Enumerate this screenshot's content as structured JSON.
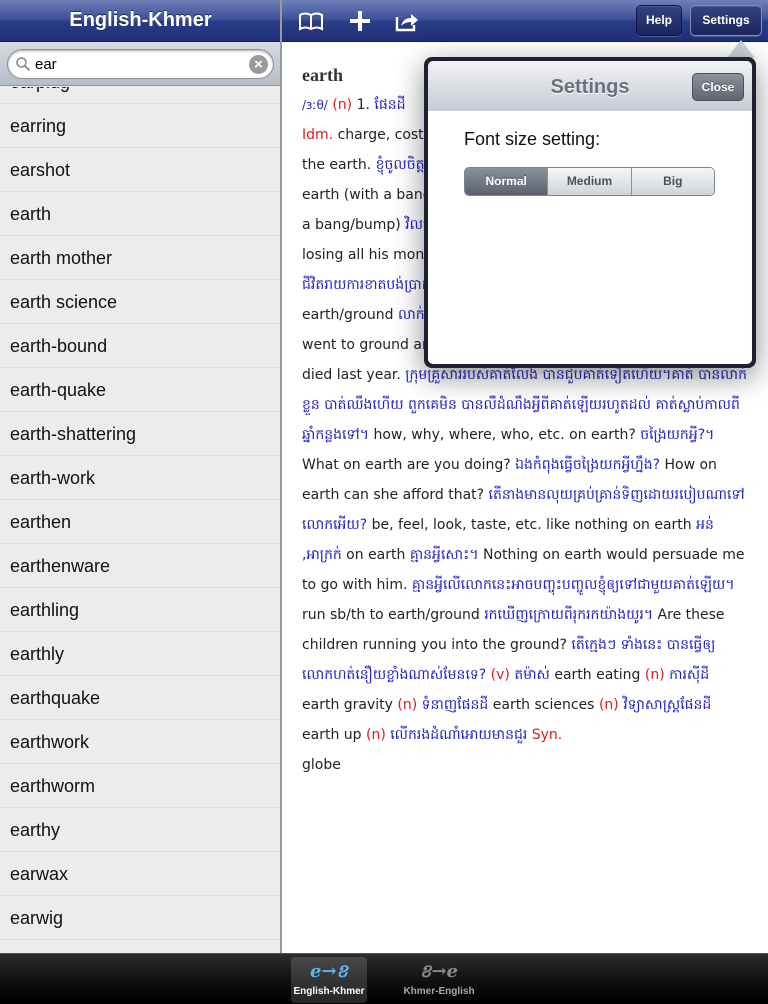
{
  "sidebar": {
    "title": "English-Khmer",
    "search": {
      "value": "ear",
      "placeholder": ""
    },
    "icons": {
      "search": "search-icon",
      "clear": "clear-icon"
    },
    "items": [
      "earplug",
      "earring",
      "earshot",
      "earth",
      "earth mother",
      "earth science",
      "earth-bound",
      "earth-quake",
      "earth-shattering",
      "earth-work",
      "earthen",
      "earthenware",
      "earthling",
      "earthly",
      "earthquake",
      "earthwork",
      "earthworm",
      "earthy",
      "earwax",
      "earwig"
    ]
  },
  "toolbar": {
    "icons": [
      "book-icon",
      "add-icon",
      "share-icon"
    ],
    "help_label": "Help",
    "settings_label": "Settings"
  },
  "entry": {
    "headword": "earth",
    "ipa": "/ɜːθ/",
    "segments": [
      [
        "pos",
        "(n)"
      ],
      [
        "en",
        " 1. "
      ],
      [
        "kh",
        "ផែនដី"
      ],
      [
        "br",
        ""
      ],
      [
        "pos",
        "Idm."
      ],
      [
        "en",
        " charge, cost, etc. the earth: I love that dress, but it costs the earth. "
      ],
      [
        "kh",
        "ខ្ញុំចូលចិត្តរ៉ូបនោះ តែវាមានតំលៃខ្ពស់ពេក"
      ],
      [
        "en",
        " come (back) down to earth (with a bang/bump); bring sb (back) down to earth (with a bang/bump) "
      ],
      [
        "kh",
        "វិលត្រឡប់មកការពិតវិញ"
      ],
      [
        "en",
        " After his wonderful holiday, losing all his money brought him back to earth with a bump. "
      ],
      [
        "kh",
        "ជីវិតរាយការខាតបង់ប្រាក់ ធ្វើឲ្យនាងក្លាយជាមនុស្សធម្មតាវិញ។"
      ],
      [
        "en",
        " go to earth/ground "
      ],
      [
        "kh",
        "លាក់បំពួន។"
      ],
      [
        "en",
        " His family never saw him again. He went to ground and they heard nothing else of him until he died last year. "
      ],
      [
        "kh",
        "ក្រុមគ្រួសាររបស់គាត់លែង បានជួបគាត់ទៀតហើយ។គាត់ បានលាក់ខ្លួន បាត់ឈឹងហើយ ពួកគេមិន បានលឺដំណឹងអ្វីពីគាត់ឡើយរហូតដល់ គាត់ស្លាប់កាលពីឆ្នាំកន្លងទៅ។"
      ],
      [
        "en",
        " how, why, where, who, etc. on earth? "
      ],
      [
        "kh",
        "ចង្រៃយកអ្វី?។"
      ],
      [
        "en",
        " What on earth are you doing? "
      ],
      [
        "kh",
        "ឯងកំពុងធ្វើចង្រៃយកអ្វីហ្នឹង?"
      ],
      [
        "en",
        " How on earth can she afford that? "
      ],
      [
        "kh",
        "តើនាងមានលុយគ្រប់គ្រាន់ទិញដោយរបៀបណាទៅលោកអើយ?"
      ],
      [
        "en",
        " be, feel, look, taste, etc. like nothing on earth "
      ],
      [
        "kh",
        "អន់ ,អាក្រក់"
      ],
      [
        "en",
        " on earth "
      ],
      [
        "kh",
        "គ្មានអ្វីសោះ។"
      ],
      [
        "en",
        " Nothing on earth would persuade me to go with him. "
      ],
      [
        "kh",
        "គ្មានអ្វីលើលោកនេះអាចបញ្ចុះបញ្ចូលខ្ញុំឲ្យទៅជាមួយគាត់ឡើយ។"
      ],
      [
        "en",
        " run sb/th to earth/ground "
      ],
      [
        "kh",
        "រកឃើញក្រោយពីរុករកយ៉ាងយូរ។"
      ],
      [
        "en",
        " Are these children running you into the ground? "
      ],
      [
        "kh",
        "តើក្មេងៗ ទាំងនេះ បានធ្វើឲ្យលោកហត់នឿយខ្លាំងណាស់មែនទេ?"
      ],
      [
        "pos",
        " (v) "
      ],
      [
        "kh",
        "តម៉ាស់"
      ],
      [
        "en",
        " earth eating "
      ],
      [
        "pos",
        " (n) "
      ],
      [
        "kh",
        "ការស៊ីដី"
      ],
      [
        "en",
        " earth gravity "
      ],
      [
        "pos",
        " (n) "
      ],
      [
        "kh",
        "ទំនាញផែនដី"
      ],
      [
        "en",
        " earth sciences "
      ],
      [
        "pos",
        " (n) "
      ],
      [
        "kh",
        "វិទ្យាសាស្ត្រផែនដី"
      ],
      [
        "en",
        " earth up "
      ],
      [
        "pos",
        " (n) "
      ],
      [
        "kh",
        "លើករងដំណាំអោយមានជួរ"
      ],
      [
        "pos",
        " Syn."
      ],
      [
        "br",
        ""
      ],
      [
        "en",
        " globe"
      ]
    ]
  },
  "settings_popover": {
    "title": "Settings",
    "close_label": "Close",
    "font_size_label": "Font size setting:",
    "options": [
      "Normal",
      "Medium",
      "Big"
    ],
    "selected": "Normal"
  },
  "tabbar": {
    "tabs": [
      {
        "label": "English-Khmer",
        "icon": "e→ខ",
        "active": true
      },
      {
        "label": "Khmer-English",
        "icon": "ខ→e",
        "active": false
      }
    ]
  },
  "colors": {
    "nav_blue": "#2b3d88",
    "khmer_text": "#2323c8",
    "pos_red": "#e01b1b"
  }
}
